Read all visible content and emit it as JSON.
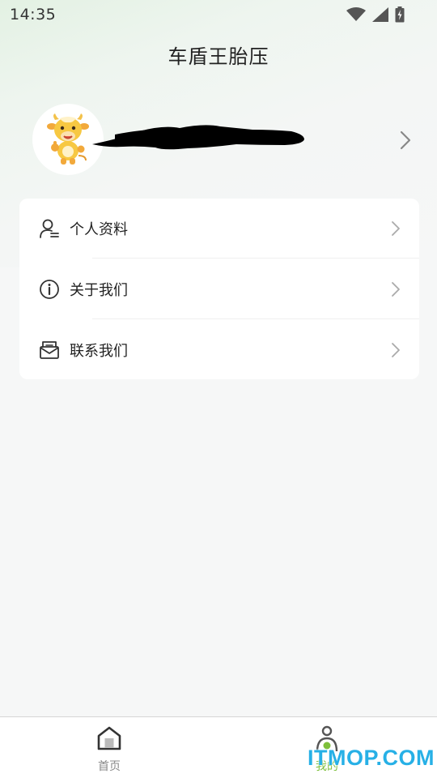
{
  "status_bar": {
    "time": "14:35",
    "icons": [
      "wifi-icon",
      "signal-icon",
      "battery-charging-icon"
    ]
  },
  "header": {
    "title": "车盾王胎压"
  },
  "profile": {
    "avatar_icon": "cow-mascot-avatar",
    "name_redacted": true
  },
  "menu": {
    "items": [
      {
        "label": "个人资料",
        "icon": "profile-icon"
      },
      {
        "label": "关于我们",
        "icon": "info-icon"
      },
      {
        "label": "联系我们",
        "icon": "mail-icon"
      }
    ]
  },
  "bottom_nav": {
    "items": [
      {
        "label": "首页",
        "icon": "home-icon",
        "active": false
      },
      {
        "label": "我的",
        "icon": "person-icon",
        "active": true
      }
    ],
    "active_color": "#7cbf3a",
    "inactive_color": "#888888"
  },
  "watermark": "ITMOP.COM"
}
